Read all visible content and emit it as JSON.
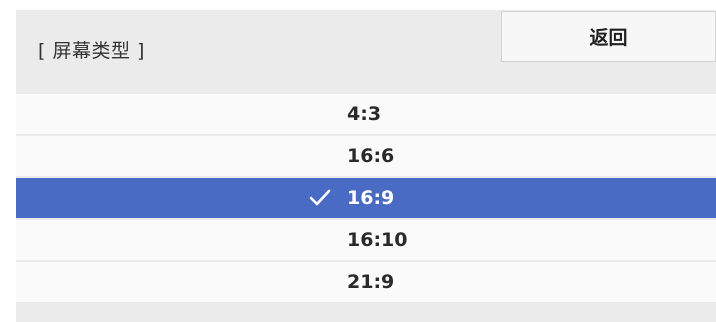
{
  "header": {
    "title": "[ 屏幕类型 ]",
    "back_label": "返回"
  },
  "options": [
    {
      "label": "4:3",
      "selected": false
    },
    {
      "label": "16:6",
      "selected": false
    },
    {
      "label": "16:9",
      "selected": true
    },
    {
      "label": "16:10",
      "selected": false
    },
    {
      "label": "21:9",
      "selected": false
    }
  ],
  "colors": {
    "selected_row": "#4a6bc4",
    "panel_background": "#ebebeb"
  },
  "icons": {
    "selected_marker": "check-icon"
  }
}
